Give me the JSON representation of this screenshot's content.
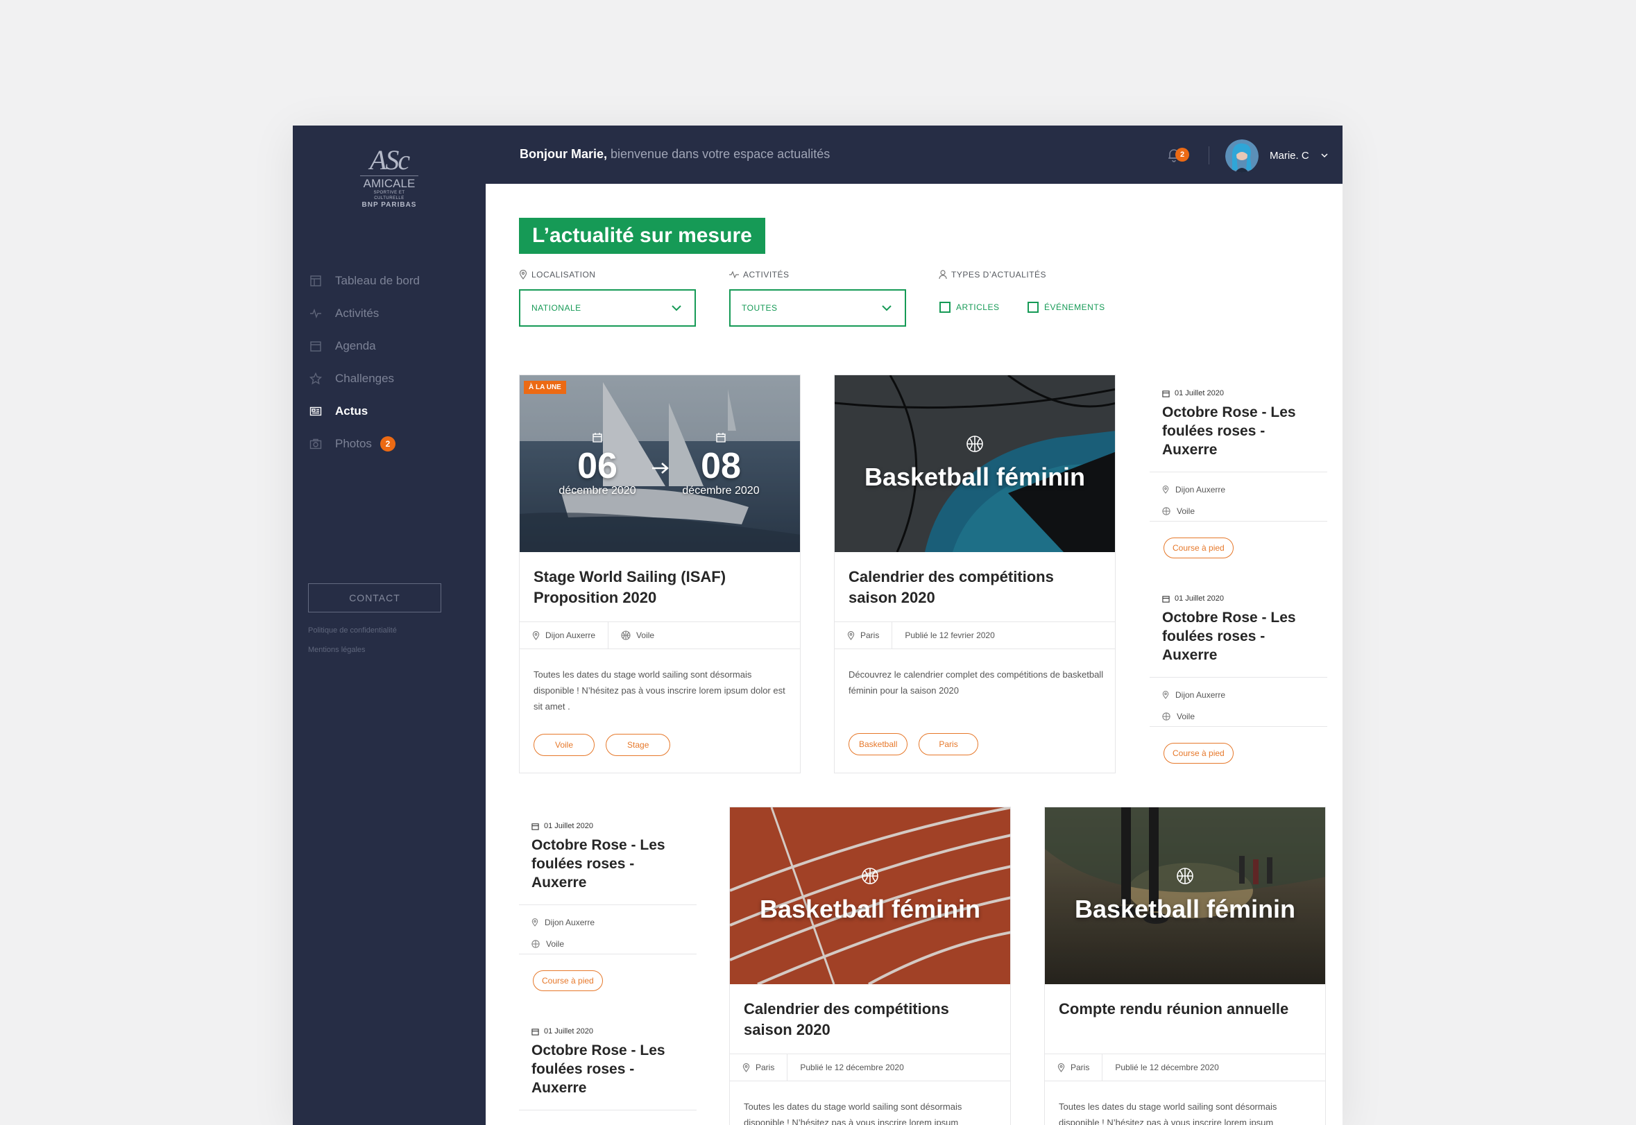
{
  "sidebar": {
    "logo": {
      "mark": "ASc",
      "line1": "AMICALE",
      "line2": "SPORTIVE ET CULTURELLE",
      "line3": "BNP PARIBAS"
    },
    "items": [
      {
        "label": "Tableau de bord",
        "icon": "dashboard-icon",
        "active": false
      },
      {
        "label": "Activités",
        "icon": "activity-icon",
        "active": false
      },
      {
        "label": "Agenda",
        "icon": "calendar-icon",
        "active": false
      },
      {
        "label": "Challenges",
        "icon": "star-icon",
        "active": false
      },
      {
        "label": "Actus",
        "icon": "news-icon",
        "active": true
      },
      {
        "label": "Photos",
        "icon": "camera-icon",
        "active": false,
        "badge": "2"
      }
    ],
    "contact_label": "CONTACT",
    "privacy_label": "Politique de confidentialité",
    "legal_label": "Mentions légales"
  },
  "topbar": {
    "greeting_name": "Bonjour Marie,",
    "greeting_rest": " bienvenue dans votre espace actualités",
    "notif_count": "2",
    "user_name": "Marie. C"
  },
  "filters": {
    "title": "L’actualité sur mesure",
    "localisation_label": "LOCALISATION",
    "localisation_value": "NATIONALE",
    "activites_label": "ACTIVITÉS",
    "activites_value": "TOUTES",
    "types_label": "TYPES D’ACTUALITÉS",
    "type_articles": "ARTICLES",
    "type_evenements": "ÉVÉNEMENTS"
  },
  "featured": {
    "badge": "À LA UNE",
    "start_day": "06",
    "start_month": "décembre 2020",
    "end_day": "08",
    "end_month": "décembre 2020",
    "title_line1": "Stage World Sailing (ISAF)",
    "title_line2": "Proposition 2020",
    "location": "Dijon Auxerre",
    "activity": "Voile",
    "text": "Toutes les dates du stage world sailing sont désormais disponible ! N’hésitez pas à vous inscrire lorem ipsum dolor est sit amet .",
    "tags": [
      "Voile",
      "Stage"
    ]
  },
  "card_basket": {
    "image_title": "Basketball féminin",
    "title_line1": "Calendrier des compétitions",
    "title_line2": "saison 2020",
    "location": "Paris",
    "published": "Publié le 12 fevrier 2020",
    "text": "Découvrez le calendrier complet des compétitions de basketball féminin pour la saison 2020",
    "tags": [
      "Basketball",
      "Paris"
    ]
  },
  "small_card": {
    "date": "01 Juillet 2020",
    "title": "Octobre Rose - Les foulées roses - Auxerre",
    "location": "Dijon Auxerre",
    "activity": "Voile",
    "tag": "Course à pied"
  },
  "card_track": {
    "image_title": "Basketball féminin",
    "title_line1": "Calendrier des compétitions",
    "title_line2": "saison 2020",
    "location": "Paris",
    "published": "Publié le 12 décembre 2020",
    "text": "Toutes les dates du stage world sailing sont désormais disponible ! N’hésitez pas à vous inscrire lorem ipsum"
  },
  "card_runners": {
    "image_title": "Basketball féminin",
    "title": "Compte rendu réunion annuelle",
    "location": "Paris",
    "published": "Publié le 12 décembre 2020",
    "text": "Toutes les dates du stage world sailing sont désormais disponible ! N’hésitez pas à vous inscrire lorem ipsum"
  },
  "colors": {
    "sidebar": "#262d45",
    "accent_green": "#169a56",
    "accent_orange": "#ec6a14"
  }
}
